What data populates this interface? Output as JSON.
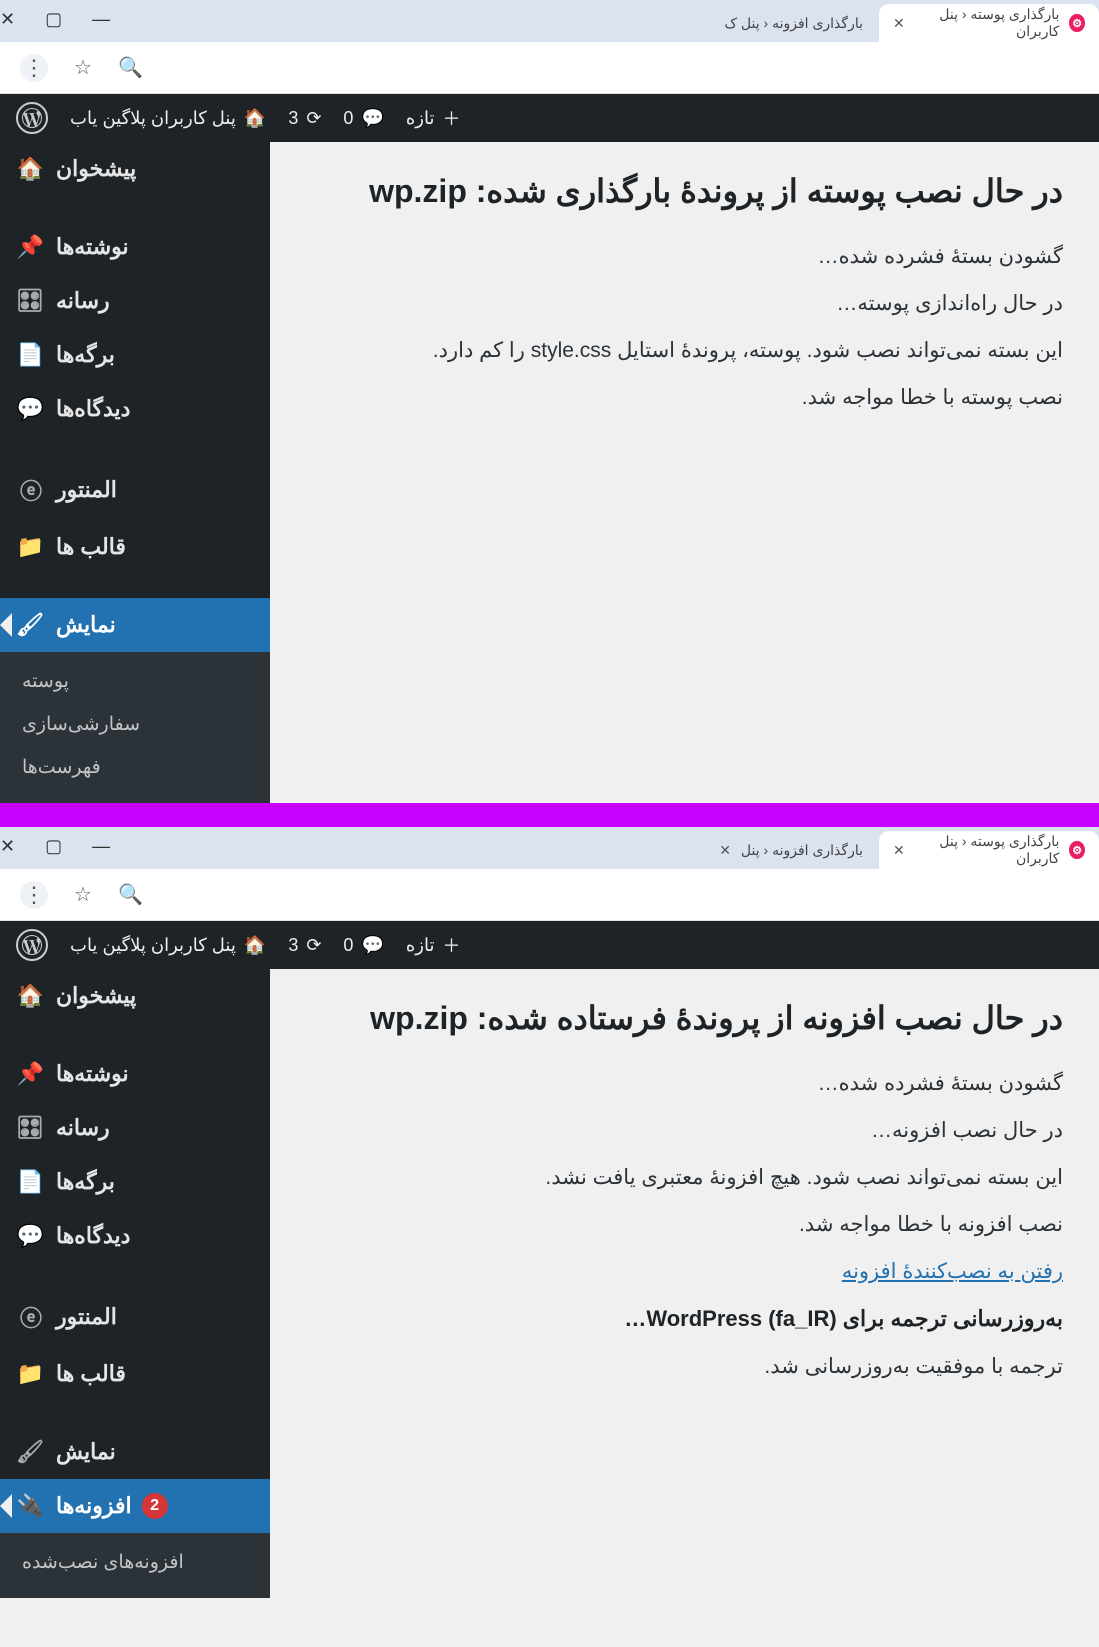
{
  "top": {
    "tabs": [
      {
        "title": "بارگذاری پوسته ‹ پنل کاربران",
        "active": true,
        "closable": true,
        "favicon": true
      },
      {
        "title": "بارگذاری افزونه ‹ پنل ک",
        "active": false,
        "closable": false,
        "favicon": false
      }
    ],
    "adminbar": {
      "site": "پنل کاربران پلاگین یاب",
      "updates": "3",
      "comments": "0",
      "new": "تازه"
    },
    "menu": [
      {
        "label": "پیشخوان",
        "icon": "dashboard"
      },
      {
        "sep": true
      },
      {
        "label": "نوشته‌ها",
        "icon": "pin"
      },
      {
        "label": "رسانه",
        "icon": "media"
      },
      {
        "label": "برگه‌ها",
        "icon": "pages"
      },
      {
        "label": "دیدگاه‌ها",
        "icon": "comments"
      },
      {
        "sep": true
      },
      {
        "label": "المنتور",
        "icon": "elementor"
      },
      {
        "label": "قالب ها",
        "icon": "folder"
      },
      {
        "sep": true
      },
      {
        "label": "نمایش",
        "icon": "brush",
        "current": true
      }
    ],
    "submenu": [
      "پوسته",
      "سفارشی‌سازی",
      "فهرست‌ها"
    ],
    "content": {
      "h1_prefix": "در حال نصب پوسته از پروندهٔ بارگذاری شده: ",
      "h1_file": "wp.zip",
      "p1": "گشودن بستهٔ فشرده شده…",
      "p2": "در حال راه‌اندازی پوسته…",
      "p3": "این بسته نمی‌تواند نصب شود. پوسته، پروندهٔ استایل style.css را کم دارد.",
      "p4": "نصب پوسته با خطا مواجه شد."
    }
  },
  "bottom": {
    "tabs": [
      {
        "title": "بارگذاری پوسته ‹ پنل کاربران",
        "active": true,
        "closable": true,
        "favicon": true
      },
      {
        "title": "بارگذاری افزونه ‹ پنل",
        "active": false,
        "closable": true,
        "favicon": false
      }
    ],
    "adminbar": {
      "site": "پنل کاربران پلاگین یاب",
      "updates": "3",
      "comments": "0",
      "new": "تازه"
    },
    "menu": [
      {
        "label": "پیشخوان",
        "icon": "dashboard"
      },
      {
        "sep": true
      },
      {
        "label": "نوشته‌ها",
        "icon": "pin"
      },
      {
        "label": "رسانه",
        "icon": "media"
      },
      {
        "label": "برگه‌ها",
        "icon": "pages"
      },
      {
        "label": "دیدگاه‌ها",
        "icon": "comments"
      },
      {
        "sep": true
      },
      {
        "label": "المنتور",
        "icon": "elementor"
      },
      {
        "label": "قالب ها",
        "icon": "folder"
      },
      {
        "sep": true
      },
      {
        "label": "نمایش",
        "icon": "brush"
      },
      {
        "label": "افزونه‌ها",
        "icon": "plug",
        "current": true,
        "badge": "2"
      }
    ],
    "submenu": [
      "افزونه‌های نصب‌شده"
    ],
    "content": {
      "h1_prefix": "در حال نصب افزونه از پروندهٔ فرستاده شده: ",
      "h1_file": "wp.zip",
      "p1": "گشودن بستهٔ فشرده شده…",
      "p2": "در حال نصب افزونه…",
      "p3": "این بسته نمی‌تواند نصب شود. هیچ افزونهٔ معتبری یافت نشد.",
      "p4": "نصب افزونه با خطا مواجه شد.",
      "link": "رفتن به نصب‌کنندهٔ افزونه",
      "sub": "به‌روزرسانی ترجمه برای WordPress (fa_IR)…",
      "p5": "ترجمه با موفقیت به‌روزرسانی شد."
    }
  }
}
